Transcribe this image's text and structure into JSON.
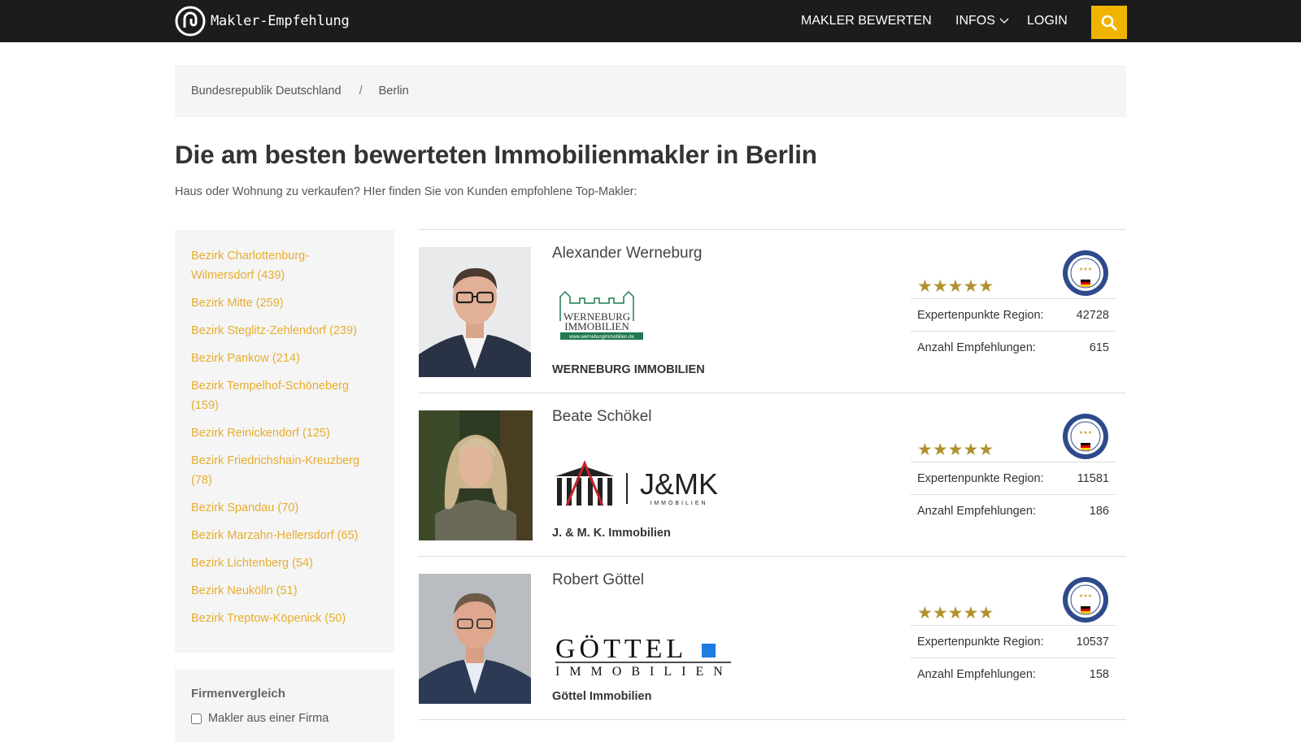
{
  "header": {
    "logo_text": "Makler-Empfehlung",
    "nav": {
      "rate": "MAKLER BEWERTEN",
      "infos": "INFOS",
      "login": "LOGIN"
    },
    "accent_color": "#f0b400"
  },
  "breadcrumb": [
    "Bundesrepublik Deutschland",
    "/",
    "Berlin"
  ],
  "page": {
    "title": "Die am besten bewerteten Immobilienmakler in Berlin",
    "subtitle": "Haus oder Wohnung zu verkaufen? HIer finden Sie von Kunden empfohlene Top-Makler:"
  },
  "sidebar": {
    "districts": [
      "Bezirk Charlottenburg-Wilmersdorf (439)",
      "Bezirk Mitte (259)",
      "Bezirk Steglitz-Zehlendorf (239)",
      "Bezirk Pankow (214)",
      "Bezirk Tempelhof-Schöneberg (159)",
      "Bezirk Reinickendorf (125)",
      "Bezirk Friedrichshain-Kreuzberg (78)",
      "Bezirk Spandau (70)",
      "Bezirk Marzahn-Hellersdorf (65)",
      "Bezirk Lichtenberg (54)",
      "Bezirk Neukölln (51)",
      "Bezirk Treptow-Köpenick (50)"
    ],
    "link_color": "#e6ad2e",
    "compare": {
      "title": "Firmenvergleich",
      "checkbox_label": "Makler aus einer Firma"
    }
  },
  "stat_labels": {
    "points": "Expertenpunkte Region:",
    "recommendations": "Anzahl Empfehlungen:"
  },
  "agents": [
    {
      "name": "Alexander Werneburg",
      "company": "WERNEBURG IMMOBILIEN",
      "logo_text_1": "WERNEBURG",
      "logo_text_2": "IMMOBILIEN",
      "logo_url": "www.werneburgimmobilien.de",
      "rating_stars": 5,
      "stars": "★★★★★",
      "points": "42728",
      "recommendations": "615"
    },
    {
      "name": "Beate Schökel",
      "company": "J. & M. K. Immobilien",
      "logo_text_1": "J&MK",
      "logo_text_2": "IMMOBILIEN",
      "rating_stars": 5,
      "stars": "★★★★★",
      "points": "11581",
      "recommendations": "186"
    },
    {
      "name": "Robert Göttel",
      "company": "Göttel Immobilien",
      "logo_text_1": "GÖTTEL",
      "logo_text_2": "IMMOBILIEN",
      "rating_stars": 5,
      "stars": "★★★★★",
      "points": "10537",
      "recommendations": "158"
    }
  ]
}
